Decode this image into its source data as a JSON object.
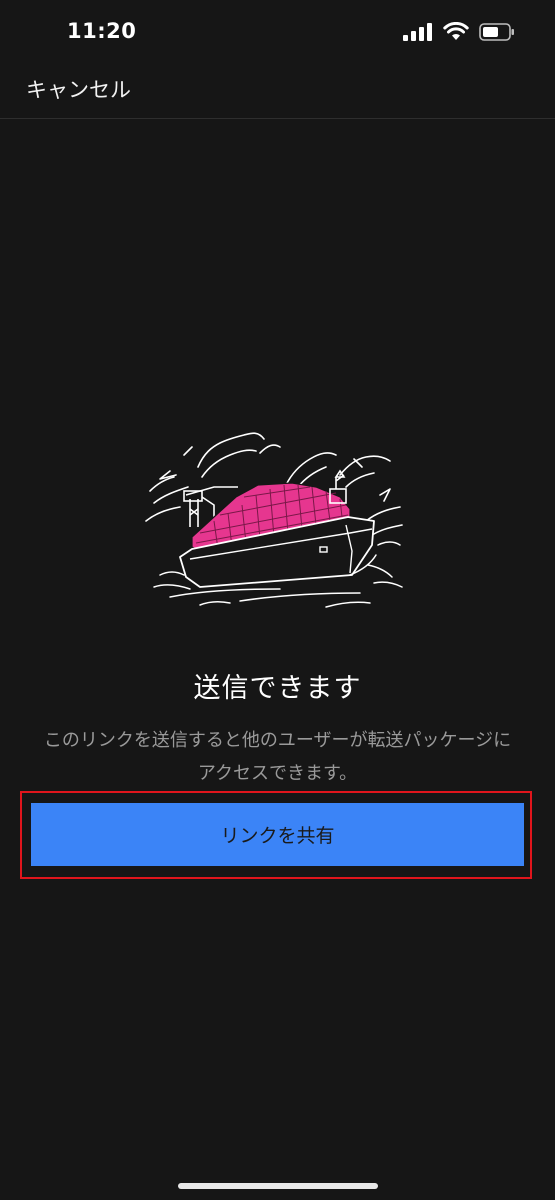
{
  "status_bar": {
    "time": "11:20",
    "icons": [
      "signal-icon",
      "wifi-icon",
      "battery-icon"
    ]
  },
  "nav": {
    "cancel_label": "キャンセル"
  },
  "content": {
    "illustration": "container-ship-illustration",
    "title": "送信できます",
    "description": "このリンクを送信すると他のユーザーが転送パッケージにアクセスできます。",
    "share_button_label": "リンクを共有"
  },
  "colors": {
    "background": "#161616",
    "accent": "#3b84f7",
    "illustration_highlight": "#e6368f",
    "annotation_outline": "#e0151c"
  }
}
